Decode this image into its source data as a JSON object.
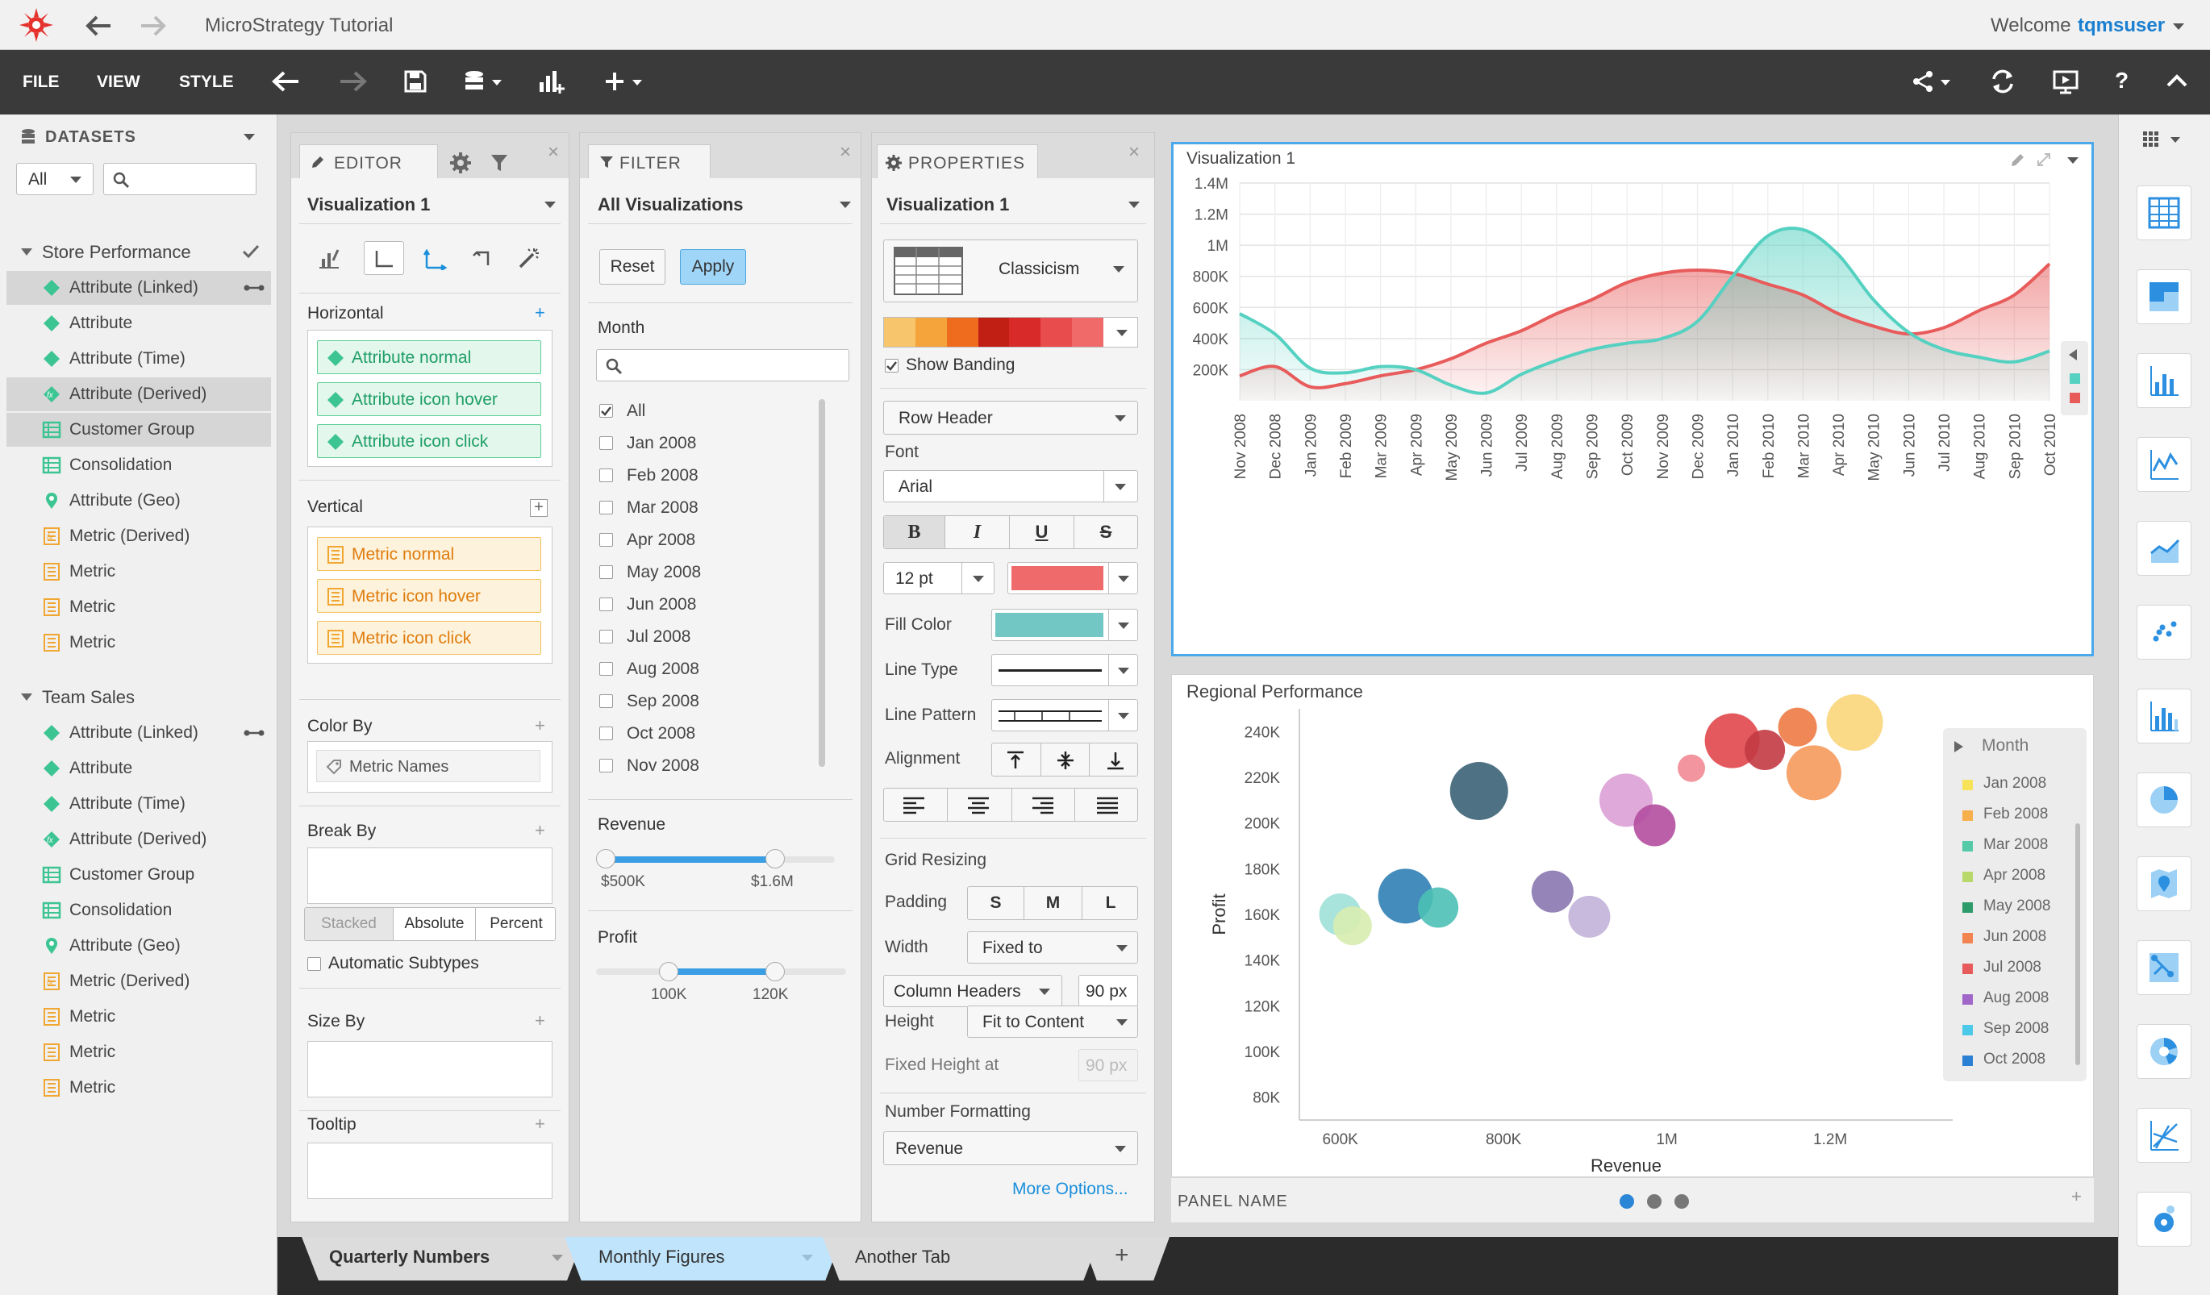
{
  "app": {
    "title": "MicroStrategy Tutorial",
    "welcome": "Welcome",
    "user": "tqmsuser"
  },
  "menu": [
    "FILE",
    "VIEW",
    "STYLE"
  ],
  "datasets": {
    "header": "DATASETS",
    "filter_value": "All",
    "search_placeholder": "",
    "groups": [
      {
        "name": "Store Performance",
        "items": [
          {
            "label": "Attribute (Linked)",
            "icon": "attribute-linked-icon"
          },
          {
            "label": "Attribute",
            "icon": "attribute-icon"
          },
          {
            "label": "Attribute (Time)",
            "icon": "attribute-time-icon"
          },
          {
            "label": "Attribute (Derived)",
            "icon": "attribute-derived-icon"
          },
          {
            "label": "Customer Group",
            "icon": "customer-group-icon"
          },
          {
            "label": "Consolidation",
            "icon": "consolidation-icon"
          },
          {
            "label": "Attribute (Geo)",
            "icon": "geo-icon"
          },
          {
            "label": "Metric (Derived)",
            "icon": "metric-derived-icon"
          },
          {
            "label": "Metric",
            "icon": "metric-icon"
          },
          {
            "label": "Metric",
            "icon": "metric-icon"
          },
          {
            "label": "Metric",
            "icon": "metric-icon"
          }
        ]
      },
      {
        "name": "Team Sales",
        "items": [
          {
            "label": "Attribute (Linked)",
            "icon": "attribute-linked-icon"
          },
          {
            "label": "Attribute",
            "icon": "attribute-icon"
          },
          {
            "label": "Attribute (Time)",
            "icon": "attribute-time-icon"
          },
          {
            "label": "Attribute (Derived)",
            "icon": "attribute-derived-icon"
          },
          {
            "label": "Customer Group",
            "icon": "customer-group-icon"
          },
          {
            "label": "Consolidation",
            "icon": "consolidation-icon"
          },
          {
            "label": "Attribute (Geo)",
            "icon": "geo-icon"
          },
          {
            "label": "Metric (Derived)",
            "icon": "metric-derived-icon"
          },
          {
            "label": "Metric",
            "icon": "metric-icon"
          },
          {
            "label": "Metric",
            "icon": "metric-icon"
          },
          {
            "label": "Metric",
            "icon": "metric-icon"
          }
        ]
      }
    ]
  },
  "editor": {
    "tab": "EDITOR",
    "viz": "Visualization 1",
    "horizontal": "Horizontal",
    "vertical": "Vertical",
    "attr_drops": [
      "Attribute normal",
      "Attribute icon hover",
      "Attribute icon click"
    ],
    "metric_drops": [
      "Metric normal",
      "Metric icon hover",
      "Metric icon click"
    ],
    "color_by": "Color By",
    "color_by_value": "Metric Names",
    "break_by": "Break By",
    "break_options": [
      "Stacked",
      "Absolute",
      "Percent"
    ],
    "auto_subtypes": "Automatic Subtypes",
    "size_by": "Size By",
    "tooltip": "Tooltip"
  },
  "filter": {
    "tab": "FILTER",
    "scope": "All Visualizations",
    "reset": "Reset",
    "apply": "Apply",
    "month_label": "Month",
    "search_placeholder": "",
    "months": [
      "All",
      "Jan 2008",
      "Feb 2008",
      "Mar 2008",
      "Apr 2008",
      "May 2008",
      "Jun 2008",
      "Jul 2008",
      "Aug 2008",
      "Sep 2008",
      "Oct 2008",
      "Nov 2008"
    ],
    "revenue": {
      "label": "Revenue",
      "min": "$500K",
      "max": "$1.6M"
    },
    "profit": {
      "label": "Profit",
      "min": "100K",
      "max": "120K"
    }
  },
  "properties": {
    "tab": "PROPERTIES",
    "viz": "Visualization 1",
    "style": "Classicism",
    "show_banding": "Show Banding",
    "row_header": "Row Header",
    "font_label": "Font",
    "font_value": "Arial",
    "size": "12 pt",
    "fill_color": "Fill Color",
    "line_type": "Line Type",
    "line_pattern": "Line Pattern",
    "alignment": "Alignment",
    "grid_resizing": "Grid Resizing",
    "padding": "Padding",
    "padding_options": [
      "S",
      "M",
      "L"
    ],
    "width": "Width",
    "width_value": "Fixed to",
    "column_headers": "Column Headers",
    "px": "90 px",
    "height": "Height",
    "height_value": "Fit to Content",
    "fixed_height": "Fixed Height at",
    "fixed_px": "90 px",
    "number_formatting": "Number Formatting",
    "metric": "Revenue",
    "more": "More Options...",
    "palette": [
      "#f7c66c",
      "#f5a43b",
      "#ef6c1e",
      "#c21f14",
      "#d82a28",
      "#e94c4c",
      "#f06a6a"
    ],
    "font_color": "#ef6b6b",
    "fill_value": "#72c7c4"
  },
  "viz1": {
    "title": "Visualization 1"
  },
  "viz2": {
    "title": "Regional Performance",
    "xlabel": "Revenue",
    "ylabel": "Profit",
    "legend_title": "Month"
  },
  "panel": {
    "name": "PANEL NAME"
  },
  "tabs": [
    "Quarterly Numbers",
    "Monthly Figures",
    "Another Tab"
  ],
  "chart_data": [
    {
      "type": "area",
      "title": "",
      "categories": [
        "Nov 2008",
        "Dec 2008",
        "Jan 2009",
        "Feb 2009",
        "Mar 2009",
        "Apr 2009",
        "May 2009",
        "Jun 2009",
        "Jul 2009",
        "Aug 2009",
        "Sep 2009",
        "Oct 2009",
        "Nov 2009",
        "Dec 2009",
        "Jan 2010",
        "Feb 2010",
        "Mar 2010",
        "Apr 2010",
        "May 2010",
        "Jun 2010",
        "Jul 2010",
        "Aug 2010",
        "Sep 2010",
        "Oct 2010"
      ],
      "ylim": [
        0,
        1400000
      ],
      "yticks": [
        "200K",
        "400K",
        "600K",
        "800K",
        "1M",
        "1.2M",
        "1.4M"
      ],
      "series": [
        {
          "color": "#e85b5b",
          "values": [
            160000,
            220000,
            90000,
            110000,
            160000,
            200000,
            270000,
            370000,
            450000,
            560000,
            650000,
            760000,
            820000,
            840000,
            820000,
            750000,
            680000,
            560000,
            480000,
            430000,
            470000,
            580000,
            680000,
            880000
          ]
        },
        {
          "color": "#55d1c1",
          "values": [
            560000,
            430000,
            210000,
            180000,
            220000,
            200000,
            100000,
            50000,
            170000,
            260000,
            330000,
            370000,
            400000,
            510000,
            800000,
            1060000,
            1100000,
            940000,
            650000,
            440000,
            330000,
            280000,
            250000,
            320000
          ]
        }
      ]
    },
    {
      "type": "scatter",
      "title": "Regional Performance",
      "xlabel": "Revenue",
      "ylabel": "Profit",
      "xlim": [
        550000,
        1350000
      ],
      "ylim": [
        70000,
        250000
      ],
      "xticks": [
        "600K",
        "800K",
        "1M",
        "1.2M"
      ],
      "yticks": [
        "80K",
        "100K",
        "120K",
        "140K",
        "160K",
        "180K",
        "200K",
        "220K",
        "240K"
      ],
      "legend": [
        "Jan 2008",
        "Feb 2008",
        "Mar 2008",
        "Apr 2008",
        "May 2008",
        "Jun 2008",
        "Jul 2008",
        "Aug 2008",
        "Sep 2008",
        "Oct 2008"
      ],
      "legend_colors": [
        "#f7e35a",
        "#f5b04c",
        "#56c9a8",
        "#b9d86b",
        "#2e9b6a",
        "#f28452",
        "#e85b5b",
        "#a066c8",
        "#4cc9e8",
        "#2b7fd4"
      ],
      "points": [
        {
          "x": 600000,
          "y": 160000,
          "r": 26,
          "color": "#9fe0d8"
        },
        {
          "x": 615000,
          "y": 155000,
          "r": 24,
          "color": "#d8ecb0"
        },
        {
          "x": 680000,
          "y": 168000,
          "r": 34,
          "color": "#2f7fb5"
        },
        {
          "x": 720000,
          "y": 163000,
          "r": 25,
          "color": "#4cc0b5"
        },
        {
          "x": 770000,
          "y": 214000,
          "r": 36,
          "color": "#3b6275"
        },
        {
          "x": 860000,
          "y": 170000,
          "r": 26,
          "color": "#8a77b0"
        },
        {
          "x": 905000,
          "y": 159000,
          "r": 26,
          "color": "#c2b3d9"
        },
        {
          "x": 950000,
          "y": 210000,
          "r": 33,
          "color": "#dca0d6"
        },
        {
          "x": 985000,
          "y": 199000,
          "r": 26,
          "color": "#b44e9e"
        },
        {
          "x": 1030000,
          "y": 224000,
          "r": 17,
          "color": "#f28a94"
        },
        {
          "x": 1080000,
          "y": 236000,
          "r": 34,
          "color": "#e0474c"
        },
        {
          "x": 1120000,
          "y": 232000,
          "r": 25,
          "color": "#c33a42"
        },
        {
          "x": 1160000,
          "y": 242000,
          "r": 24,
          "color": "#ee7a44"
        },
        {
          "x": 1180000,
          "y": 222000,
          "r": 34,
          "color": "#f59a5c"
        },
        {
          "x": 1230000,
          "y": 244000,
          "r": 35,
          "color": "#f9d57a"
        }
      ]
    }
  ]
}
